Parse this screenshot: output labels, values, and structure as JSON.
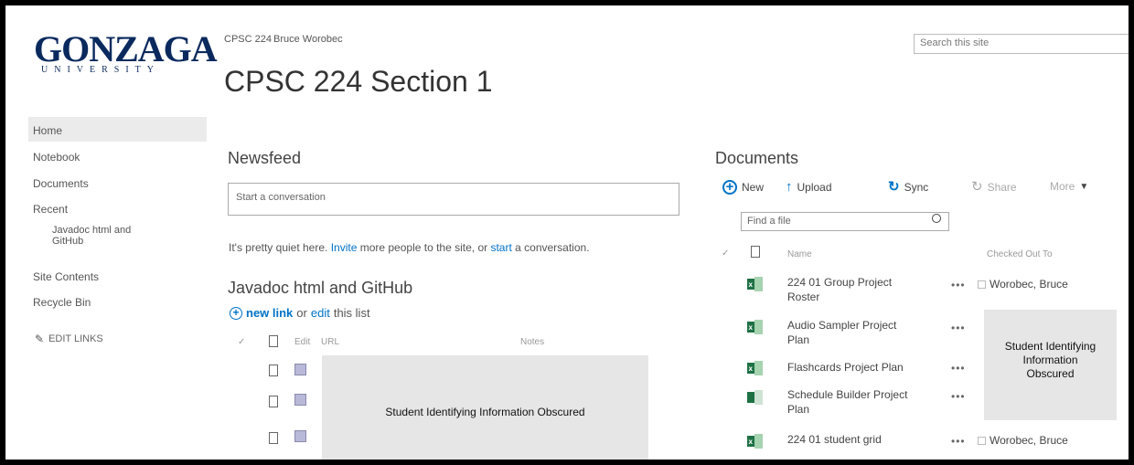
{
  "logo": {
    "main": "GONZAGA",
    "sub": "UNIVERSITY"
  },
  "header": {
    "breadcrumb": [
      "CPSC 224",
      "Bruce Worobec"
    ],
    "title": "CPSC 224 Section 1",
    "search_placeholder": "Search this site"
  },
  "nav": {
    "items": [
      "Home",
      "Notebook",
      "Documents",
      "Recent"
    ],
    "recent_child": [
      "Javadoc html and",
      "GitHub"
    ],
    "items2": [
      "Site Contents",
      "Recycle Bin"
    ],
    "edit_links": "EDIT LINKS"
  },
  "newsfeed": {
    "title": "Newsfeed",
    "placeholder": "Start a conversation",
    "quiet_pre": "It's pretty quiet here. ",
    "invite": "Invite",
    "quiet_mid": " more people to the site, or ",
    "start": "start",
    "quiet_post": " a conversation."
  },
  "links_list": {
    "title": "Javadoc html and GitHub",
    "new_link": "new link",
    "or": "or",
    "edit": "edit",
    "this_list": "this list",
    "headers": {
      "edit": "Edit",
      "url": "URL",
      "notes": "Notes"
    },
    "obscured": "Student Identifying Information Obscured"
  },
  "documents": {
    "title": "Documents",
    "toolbar": {
      "new": "New",
      "upload": "Upload",
      "sync": "Sync",
      "share": "Share",
      "more": "More"
    },
    "find_placeholder": "Find a file",
    "headers": {
      "name": "Name",
      "checked_out": "Checked Out To"
    },
    "rows": [
      {
        "name1": "224 01 Group Project",
        "name2": "Roster",
        "checked": "Worobec, Bruce"
      },
      {
        "name1": "Audio Sampler Project",
        "name2": "Plan"
      },
      {
        "name1": "Flashcards Project Plan"
      },
      {
        "name1": "Schedule Builder Project",
        "name2": "Plan"
      },
      {
        "name1": "224 01 student grid",
        "checked": "Worobec, Bruce"
      }
    ],
    "obscured": [
      "Student Identifying",
      "Information",
      "Obscured"
    ]
  },
  "colors": {
    "link": "#0072c6",
    "logo": "#0a2a5e",
    "excel": "#1e7145"
  }
}
